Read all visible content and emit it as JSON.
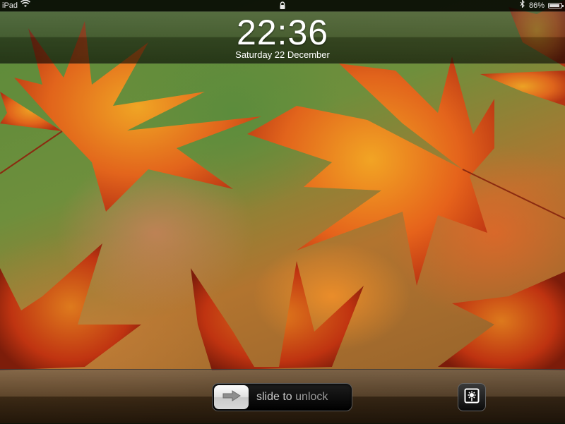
{
  "status_bar": {
    "device": "iPad",
    "battery": "86%",
    "battery_level": 0.86,
    "icons": [
      "wifi-icon",
      "lock-icon",
      "bluetooth-icon",
      "battery-icon"
    ]
  },
  "lock_screen": {
    "time": "22:36",
    "date": "Saturday 22 December"
  },
  "unlock": {
    "label_part1": "slide",
    "label_part2": " to ",
    "label_part3": "unlock",
    "knob_icon": "arrow-right-icon"
  },
  "picture_frame": {
    "icon": "picture-frame-icon"
  },
  "colors": {
    "leaf_orange": "#e8621a",
    "leaf_red": "#c0300f",
    "leaf_yellow": "#f4a21c",
    "background_green": "#5a8a3a"
  }
}
